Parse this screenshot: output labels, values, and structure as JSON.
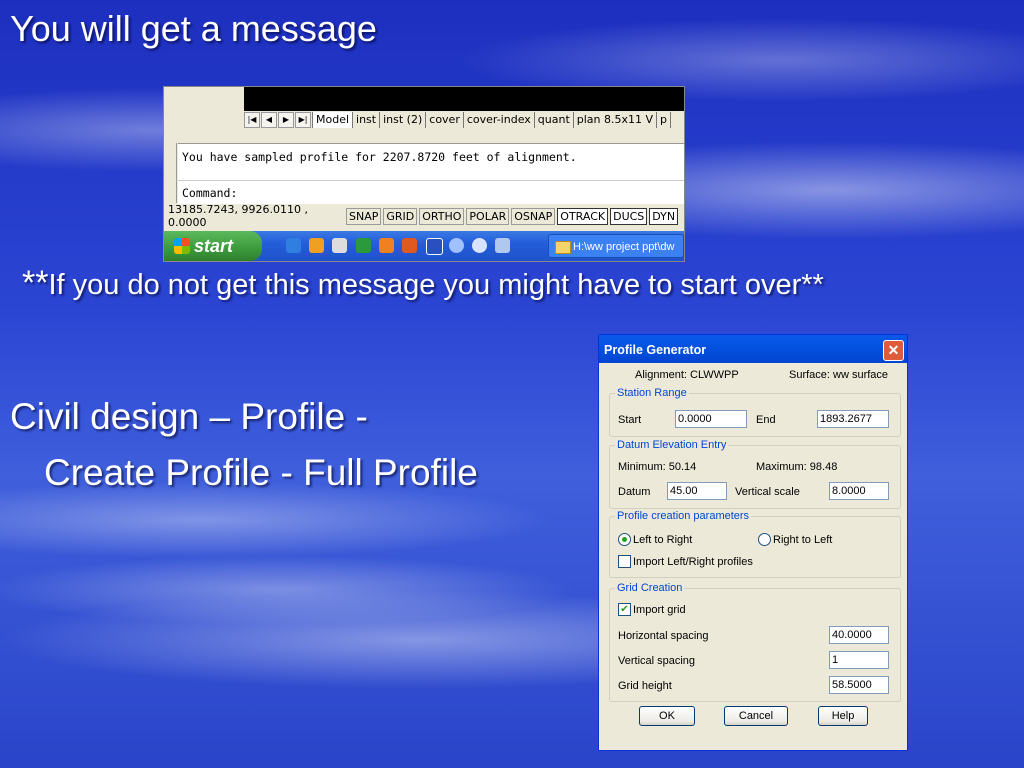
{
  "slide": {
    "title": "You will get a message",
    "note_stars": "**",
    "note_text": "If you do not get this message you might have to start over**",
    "bullet1": "Civil design – Profile -",
    "bullet2": "Create Profile - Full Profile"
  },
  "acad": {
    "tabs": [
      "Model",
      "inst",
      "inst (2)",
      "cover",
      "cover-index",
      "quant",
      "plan 8.5x11 V",
      "p"
    ],
    "nav_icons": [
      "first-icon",
      "prev-icon",
      "next-icon",
      "last-icon"
    ],
    "cmd_line1": "You have sampled profile for 2207.8720 feet of alignment.",
    "cmd_line2": "Command:",
    "coords": "13185.7243, 9926.0110 , 0.0000",
    "status_buttons": [
      "SNAP",
      "GRID",
      "ORTHO",
      "POLAR",
      "OSNAP",
      "OTRACK",
      "DUCS",
      "DYN"
    ],
    "taskbar": {
      "start": "start",
      "item": "H:\\ww project ppt\\dw"
    }
  },
  "dialog": {
    "title": "Profile Generator",
    "alignment": "Alignment: CLWWPP",
    "surface": "Surface: ww surface",
    "station_range": {
      "legend": "Station Range",
      "start_label": "Start",
      "start_value": "0.0000",
      "end_label": "End",
      "end_value": "1893.2677"
    },
    "datum": {
      "legend": "Datum Elevation Entry",
      "minimum": "Minimum: 50.14",
      "maximum": "Maximum: 98.48",
      "datum_label": "Datum",
      "datum_value": "45.00",
      "vscale_label": "Vertical scale",
      "vscale_value": "8.0000"
    },
    "params": {
      "legend": "Profile creation parameters",
      "left_to_right": "Left to Right",
      "right_to_left": "Right to Left",
      "import_lr": "Import Left/Right profiles"
    },
    "grid": {
      "legend": "Grid Creation",
      "import_grid": "Import grid",
      "hspacing_label": "Horizontal spacing",
      "hspacing_value": "40.0000",
      "vspacing_label": "Vertical spacing",
      "vspacing_value": "1",
      "height_label": "Grid height",
      "height_value": "58.5000"
    },
    "buttons": {
      "ok": "OK",
      "cancel": "Cancel",
      "help": "Help"
    }
  }
}
